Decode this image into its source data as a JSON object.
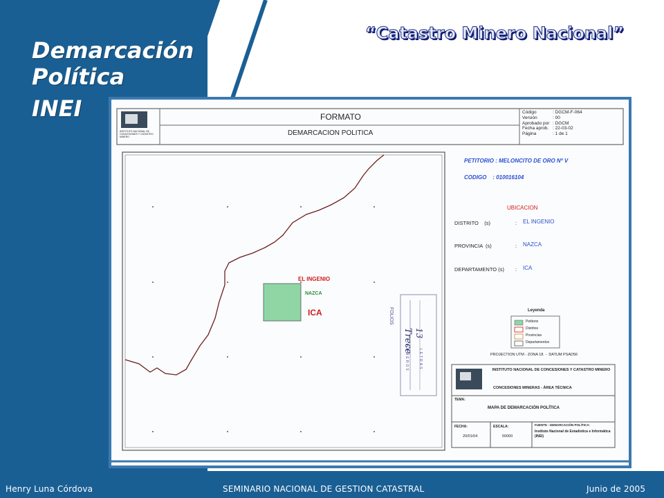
{
  "slide": {
    "title_lines": [
      "Demarcación",
      "Política",
      "INEI"
    ],
    "heading": "“Catastro Minero Nacional”"
  },
  "document": {
    "header": {
      "format_label": "FORMATO",
      "subject": "DEMARCACION POLITICA",
      "logo_text": "INSTITUTO NACIONAL DE CONCESIONES Y CATASTRO MINERO",
      "meta": [
        {
          "key": "Código",
          "value": ": DGCM-F-064"
        },
        {
          "key": "Versión",
          "value": ": 00"
        },
        {
          "key": "Aprobado por",
          "value": ": DGCM"
        },
        {
          "key": "Fecha aprob.",
          "value": ": 22-03-02"
        },
        {
          "key": "Página",
          "value": ": 1 de 1"
        }
      ]
    },
    "map": {
      "place_labels": [
        "EL INGENIO",
        "NAZCA",
        "ICA"
      ],
      "stamp_lines": [
        "FOLIOS",
        "Trece",
        "13",
        "LETRAS",
        "NUMEROS"
      ]
    },
    "info": {
      "petitorio": "PETITORIO : MELONCITO DE ORO Nº V",
      "codigo": "CODIGO    : 010016104",
      "ubicacion": "UBICACION",
      "rows": [
        {
          "key": "DISTRITO    (s)",
          "sep": ":",
          "value": "EL INGENIO"
        },
        {
          "key": "PROVINCIA  (s)",
          "sep": ":",
          "value": "NAZCA"
        },
        {
          "key": "DEPARTAMENTO (s)",
          "sep": ":",
          "value": "ICA"
        }
      ]
    },
    "legend": {
      "title": "Leyenda",
      "items": [
        "Petitorio",
        "Distritos",
        "Provincias",
        "Departamentos"
      ]
    },
    "projection": "PROJECTION UTM - ZONA 18  -  DATUM PSAD56",
    "title_block": {
      "institute": "INSTITUTO NACIONAL DE CONCESIONES Y CATASTRO MINERO",
      "dept": "CONCESIONES MINERAS - ÁREA TÉCNICA",
      "tema_label": "TEMA:",
      "tema": "MAPA DE DEMARCACIÓN POLÍTICA",
      "fecha_label": "FECHA:",
      "fecha": "20/01/04",
      "escala_label": "ESCALA:",
      "escala": "50000",
      "fuente_label": "FUENTE : DEMARCACIÓN POLÍTICA:",
      "fuente": "Instituto Nacional de Estadística e Informática (INEI)"
    }
  },
  "colors": {
    "brand_blue": "#1a5f94",
    "petitorio_fill": "#8fd6a4",
    "district_red": "#d01c1c",
    "province_green": "#2b8c3a",
    "label_blue": "#2a4fd0"
  },
  "footer": {
    "author": "Henry Luna Córdova",
    "event": "SEMINARIO NACIONAL DE GESTION CATASTRAL",
    "date": "Junio de 2005"
  }
}
